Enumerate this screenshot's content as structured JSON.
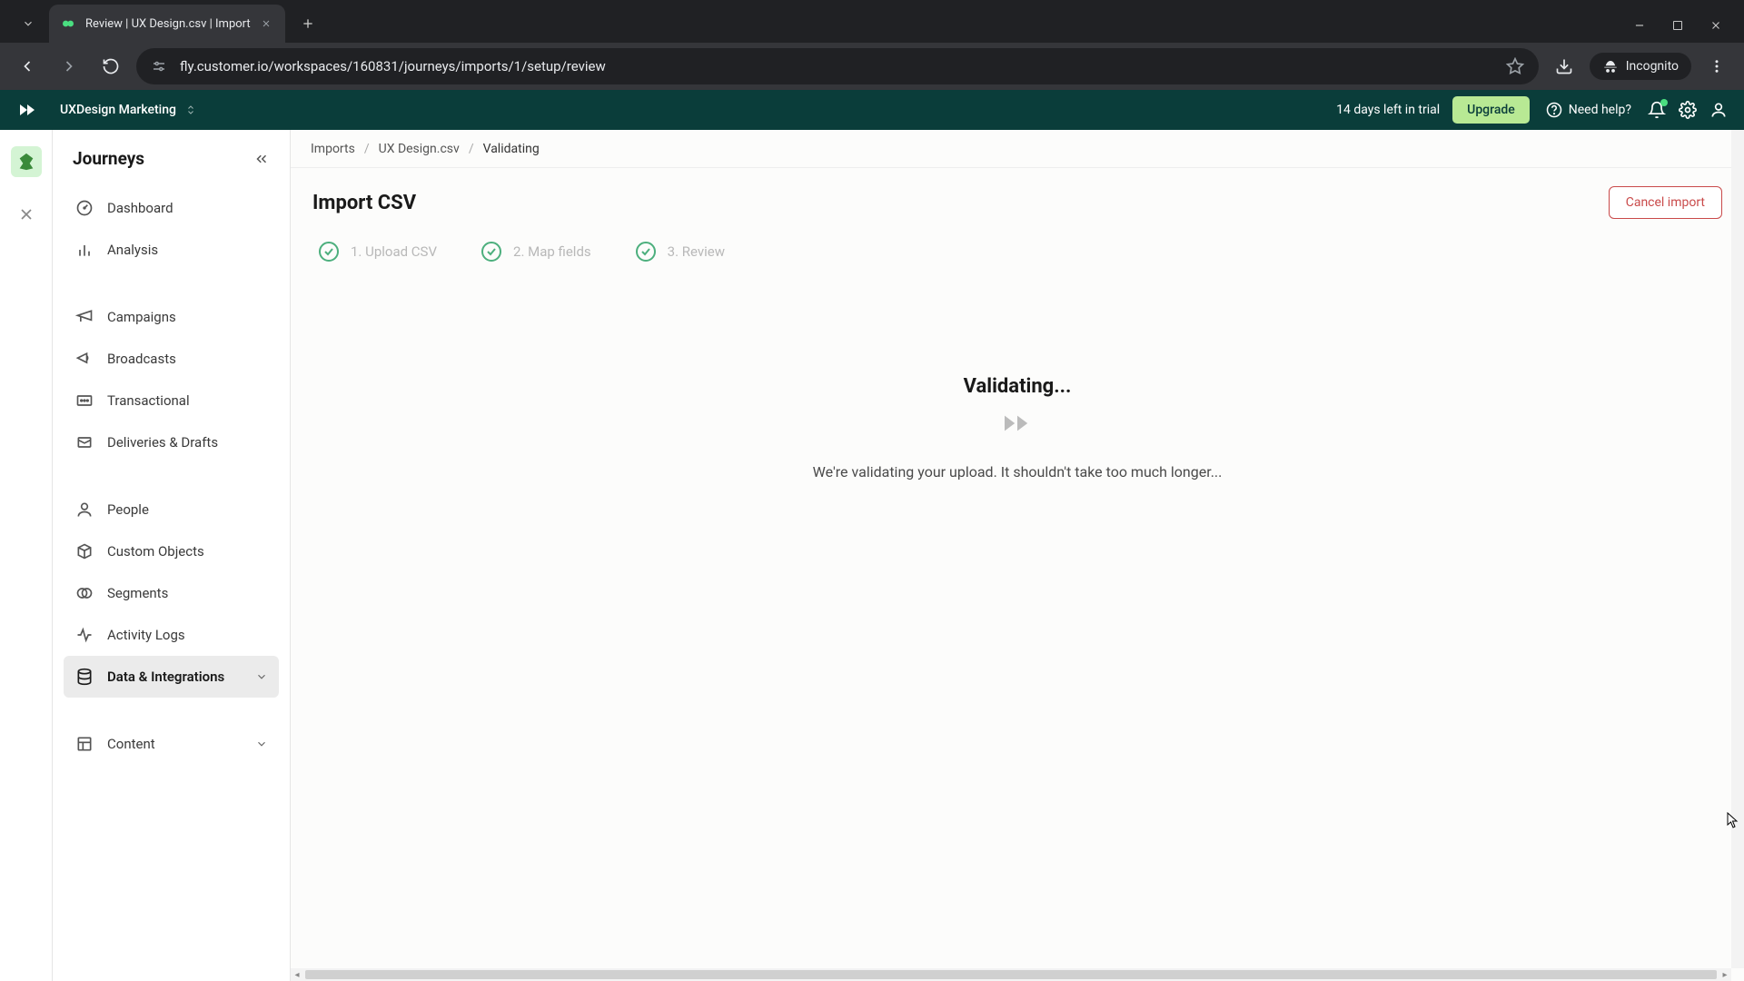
{
  "browser": {
    "tab_title": "Review | UX Design.csv | Import",
    "url": "fly.customer.io/workspaces/160831/journeys/imports/1/setup/review",
    "incognito_label": "Incognito"
  },
  "header": {
    "workspace_name": "UXDesign Marketing",
    "trial_text": "14 days left in trial",
    "upgrade_label": "Upgrade",
    "need_help_label": "Need help?"
  },
  "sidebar": {
    "title": "Journeys",
    "items": {
      "dashboard": "Dashboard",
      "analysis": "Analysis",
      "campaigns": "Campaigns",
      "broadcasts": "Broadcasts",
      "transactional": "Transactional",
      "deliveries": "Deliveries & Drafts",
      "people": "People",
      "custom_objects": "Custom Objects",
      "segments": "Segments",
      "activity_logs": "Activity Logs",
      "data_integrations": "Data & Integrations",
      "content": "Content"
    }
  },
  "breadcrumb": {
    "imports": "Imports",
    "file": "UX Design.csv",
    "current": "Validating"
  },
  "page": {
    "title": "Import CSV",
    "cancel_label": "Cancel import",
    "steps": {
      "s1": "1. Upload CSV",
      "s2": "2. Map fields",
      "s3": "3. Review"
    },
    "validating": {
      "title": "Validating...",
      "text": "We're validating your upload. It shouldn't take too much longer..."
    }
  }
}
